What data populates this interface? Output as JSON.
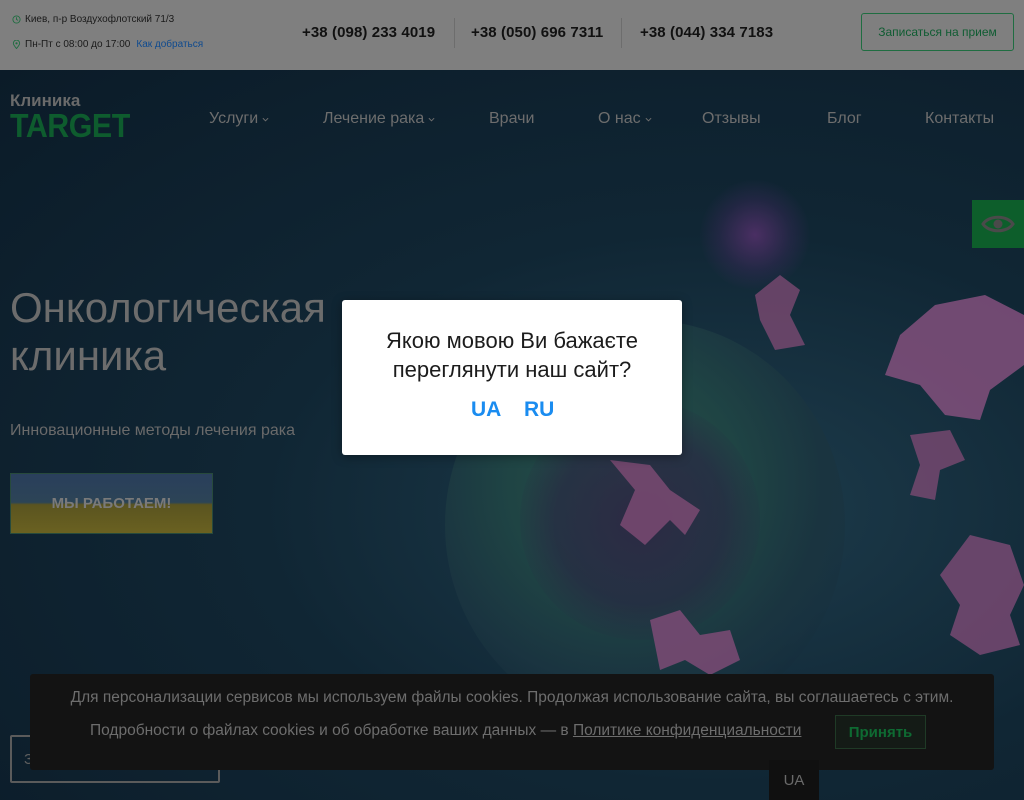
{
  "topbar": {
    "address": "Киев, п-р Воздухофлотский 71/3",
    "hours": "Пн-Пт с 08:00 до 17:00",
    "route_link": "Как добраться",
    "phones": [
      "+38 (098) 233 4019",
      "+38 (050) 696 7311",
      "+38 (044) 334 7183"
    ],
    "appointment_button": "Записаться на прием"
  },
  "logo": {
    "top": "Клиника",
    "main": "TARGET"
  },
  "nav": {
    "items": [
      {
        "label": "Услуги",
        "has_dropdown": true
      },
      {
        "label": "Лечение рака",
        "has_dropdown": true
      },
      {
        "label": "Врачи",
        "has_dropdown": false
      },
      {
        "label": "О нас",
        "has_dropdown": true
      },
      {
        "label": "Отзывы",
        "has_dropdown": false
      },
      {
        "label": "Блог",
        "has_dropdown": false
      },
      {
        "label": "Контакты",
        "has_dropdown": false
      }
    ]
  },
  "accessibility_button_icon": "eye-icon",
  "hero": {
    "title_line1": "Онкологическая",
    "title_line2": "клиника",
    "subtitle": "Инновационные методы лечения рака",
    "work_button": "МЫ РАБОТАЕМ!",
    "outline_button": "З"
  },
  "language_modal": {
    "question_line1": "Якою мовою Ви бажаєте",
    "question_line2": "переглянути наш сайт?",
    "options": [
      "UA",
      "RU"
    ]
  },
  "cookie_banner": {
    "line1": "Для персонализации сервисов мы используем файлы cookies. Продолжая использование сайта, вы соглашаетесь с этим.",
    "line2_prefix": "Подробности о файлах cookies и об обработке ваших данных — в",
    "policy_link": "Политике конфиденциальности",
    "accept_button": "Принять"
  },
  "language_tab": "UA",
  "colors": {
    "brand_green": "#0e5c2e",
    "link_blue": "#1a8cf0",
    "modal_bg": "#ffffff",
    "cookie_bg": "#131313"
  }
}
